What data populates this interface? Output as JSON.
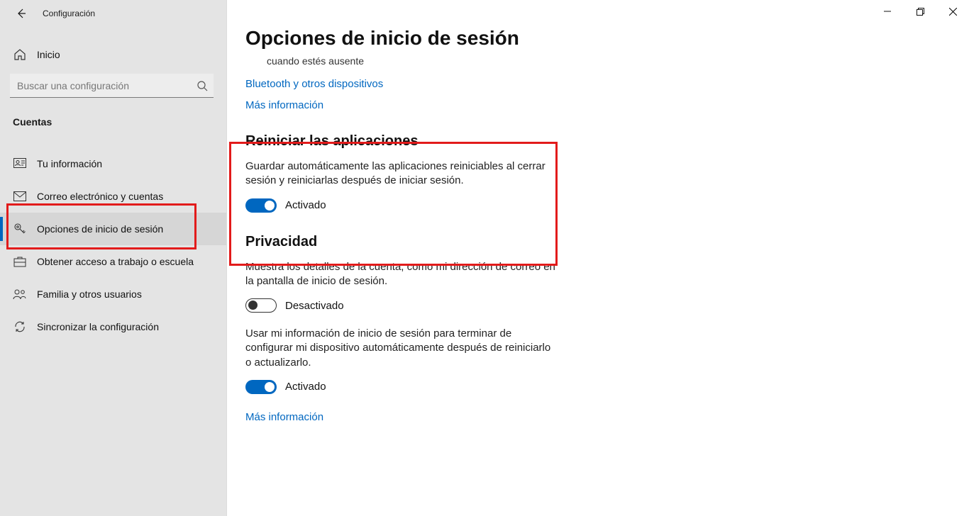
{
  "appTitle": "Configuración",
  "home": "Inicio",
  "search": {
    "placeholder": "Buscar una configuración"
  },
  "sectionLabel": "Cuentas",
  "nav": [
    {
      "label": "Tu información"
    },
    {
      "label": "Correo electrónico y cuentas"
    },
    {
      "label": "Opciones de inicio de sesión"
    },
    {
      "label": "Obtener acceso a trabajo o escuela"
    },
    {
      "label": "Familia y otros usuarios"
    },
    {
      "label": "Sincronizar la configuración"
    }
  ],
  "pageTitle": "Opciones de inicio de sesión",
  "truncated": "cuando estés ausente",
  "link1": "Bluetooth y otros dispositivos",
  "link2": "Más información",
  "restart": {
    "title": "Reiniciar las aplicaciones",
    "desc": "Guardar automáticamente las aplicaciones reiniciables al cerrar sesión y reiniciarlas después de iniciar sesión.",
    "state": "Activado"
  },
  "privacy": {
    "title": "Privacidad",
    "desc1": "Muestra los detalles de la cuenta, como mi dirección de correo en la pantalla de inicio de sesión.",
    "state1": "Desactivado",
    "desc2": "Usar mi información de inicio de sesión para terminar de configurar mi dispositivo automáticamente después de reiniciarlo o actualizarlo.",
    "state2": "Activado",
    "moreInfo": "Más información"
  }
}
